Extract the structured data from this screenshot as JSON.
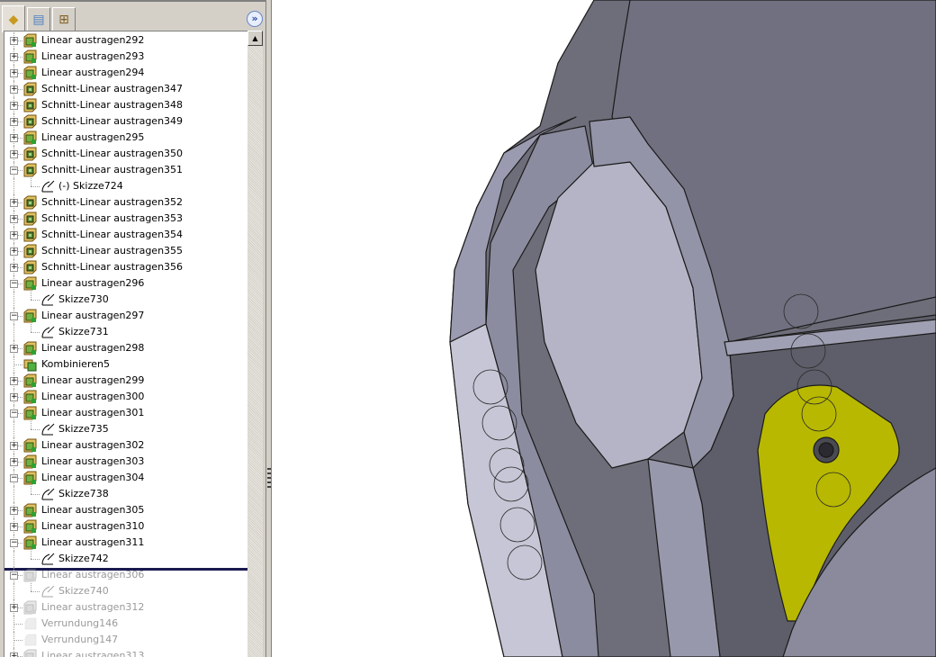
{
  "tabs": [
    {
      "name": "feature-manager",
      "icon": "feature-tree-icon"
    },
    {
      "name": "property-manager",
      "icon": "property-icon"
    },
    {
      "name": "configuration-manager",
      "icon": "configuration-icon"
    }
  ],
  "expand_label": "»",
  "scroll_up": "▲",
  "tree": [
    {
      "label": "Linear austragen292",
      "type": "extrude",
      "level": 0,
      "exp": "+"
    },
    {
      "label": "Linear austragen293",
      "type": "extrude",
      "level": 0,
      "exp": "+"
    },
    {
      "label": "Linear austragen294",
      "type": "extrude",
      "level": 0,
      "exp": "+"
    },
    {
      "label": "Schnitt-Linear austragen347",
      "type": "cut",
      "level": 0,
      "exp": "+"
    },
    {
      "label": "Schnitt-Linear austragen348",
      "type": "cut",
      "level": 0,
      "exp": "+"
    },
    {
      "label": "Schnitt-Linear austragen349",
      "type": "cut",
      "level": 0,
      "exp": "+"
    },
    {
      "label": "Linear austragen295",
      "type": "extrude",
      "level": 0,
      "exp": "+"
    },
    {
      "label": "Schnitt-Linear austragen350",
      "type": "cut",
      "level": 0,
      "exp": "+"
    },
    {
      "label": "Schnitt-Linear austragen351",
      "type": "cut",
      "level": 0,
      "exp": "-"
    },
    {
      "label": "(-) Skizze724",
      "type": "sketch",
      "level": 1
    },
    {
      "label": "Schnitt-Linear austragen352",
      "type": "cut",
      "level": 0,
      "exp": "+"
    },
    {
      "label": "Schnitt-Linear austragen353",
      "type": "cut",
      "level": 0,
      "exp": "+"
    },
    {
      "label": "Schnitt-Linear austragen354",
      "type": "cut",
      "level": 0,
      "exp": "+"
    },
    {
      "label": "Schnitt-Linear austragen355",
      "type": "cut",
      "level": 0,
      "exp": "+"
    },
    {
      "label": "Schnitt-Linear austragen356",
      "type": "cut",
      "level": 0,
      "exp": "+"
    },
    {
      "label": "Linear austragen296",
      "type": "extrude",
      "level": 0,
      "exp": "-"
    },
    {
      "label": "Skizze730",
      "type": "sketch",
      "level": 1
    },
    {
      "label": "Linear austragen297",
      "type": "extrude",
      "level": 0,
      "exp": "-"
    },
    {
      "label": "Skizze731",
      "type": "sketch",
      "level": 1
    },
    {
      "label": "Linear austragen298",
      "type": "extrude",
      "level": 0,
      "exp": "+"
    },
    {
      "label": "Kombinieren5",
      "type": "combine",
      "level": 0
    },
    {
      "label": "Linear austragen299",
      "type": "extrude",
      "level": 0,
      "exp": "+"
    },
    {
      "label": "Linear austragen300",
      "type": "extrude",
      "level": 0,
      "exp": "+"
    },
    {
      "label": "Linear austragen301",
      "type": "extrude",
      "level": 0,
      "exp": "-"
    },
    {
      "label": "Skizze735",
      "type": "sketch",
      "level": 1
    },
    {
      "label": "Linear austragen302",
      "type": "extrude",
      "level": 0,
      "exp": "+"
    },
    {
      "label": "Linear austragen303",
      "type": "extrude",
      "level": 0,
      "exp": "+"
    },
    {
      "label": "Linear austragen304",
      "type": "extrude",
      "level": 0,
      "exp": "-"
    },
    {
      "label": "Skizze738",
      "type": "sketch",
      "level": 1
    },
    {
      "label": "Linear austragen305",
      "type": "extrude",
      "level": 0,
      "exp": "+"
    },
    {
      "label": "Linear austragen310",
      "type": "extrude",
      "level": 0,
      "exp": "+"
    },
    {
      "label": "Linear austragen311",
      "type": "extrude",
      "level": 0,
      "exp": "-"
    },
    {
      "label": "Skizze742",
      "type": "sketch",
      "level": 1
    },
    {
      "label": "Linear austragen306",
      "type": "extrude",
      "level": 0,
      "exp": "-",
      "suppressed": true
    },
    {
      "label": "Skizze740",
      "type": "sketch",
      "level": 1,
      "suppressed": true
    },
    {
      "label": "Linear austragen312",
      "type": "extrude",
      "level": 0,
      "exp": "+",
      "suppressed": true
    },
    {
      "label": "Verrundung146",
      "type": "fillet",
      "level": 0,
      "suppressed": true
    },
    {
      "label": "Verrundung147",
      "type": "fillet",
      "level": 0,
      "suppressed": true
    },
    {
      "label": "Linear austragen313",
      "type": "extrude",
      "level": 0,
      "exp": "+",
      "suppressed": true
    }
  ],
  "colors": {
    "model": "#8a8a96",
    "highlight": "#b8b800",
    "rollback": "#1a1a50"
  }
}
